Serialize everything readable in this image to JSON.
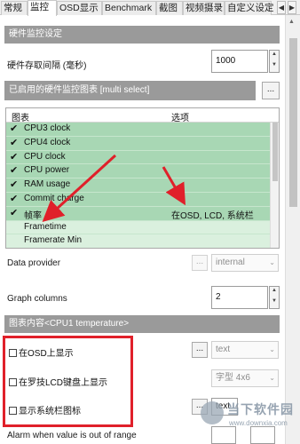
{
  "tabs": [
    "常规",
    "监控",
    "OSD显示",
    "Benchmark",
    "截图",
    "视频摄录",
    "自定义设定"
  ],
  "tab_nav": {
    "prev": "◀",
    "next": "▶"
  },
  "hw_section": {
    "title": "硬件监控设定"
  },
  "polling": {
    "label": "硬件存取间隔 (毫秒)",
    "value": "1000"
  },
  "enabled_graphs": {
    "title": "已启用的硬件监控图表 [multi select]",
    "more": "..."
  },
  "graph_list": {
    "col_graph": "图表",
    "col_options": "选项",
    "rows": [
      {
        "check": "✔",
        "name": "CPU3 clock",
        "opts": ""
      },
      {
        "check": "✔",
        "name": "CPU4 clock",
        "opts": ""
      },
      {
        "check": "✔",
        "name": "CPU clock",
        "opts": ""
      },
      {
        "check": "✔",
        "name": "CPU power",
        "opts": ""
      },
      {
        "check": "✔",
        "name": "RAM usage",
        "opts": ""
      },
      {
        "check": "✔",
        "name": "Commit charge",
        "opts": ""
      },
      {
        "check": "✔",
        "name": "帧率",
        "opts": "在OSD, LCD, 系统栏"
      },
      {
        "check": "",
        "name": "Frametime",
        "opts": ""
      },
      {
        "check": "",
        "name": "Framerate Min",
        "opts": ""
      }
    ]
  },
  "data_provider": {
    "label": "Data provider",
    "more": "...",
    "value": "internal",
    "arrow": "⌄"
  },
  "graph_columns": {
    "label": "Graph columns",
    "value": "2"
  },
  "graph_content": {
    "title": "图表内容<CPU1 temperature>"
  },
  "osd_show": {
    "label": "在OSD上显示",
    "more": "...",
    "value": "text",
    "arrow": "⌄"
  },
  "lcd_show": {
    "label": "在罗技LCD键盘上显示",
    "value": "字型 4x6",
    "arrow": "⌄"
  },
  "tray_show": {
    "label": "显示系统栏图标",
    "more": "...",
    "value": "text"
  },
  "alarm": {
    "label": "Alarm when value is out of range"
  },
  "watermark": {
    "title": "当下软件园",
    "url": "www.downxia.com"
  },
  "colors": {
    "highlight": "#e0202a",
    "arrow": "#e0202a",
    "list_checked": "#a8d7b4",
    "section_header": "#9a9a9a"
  }
}
